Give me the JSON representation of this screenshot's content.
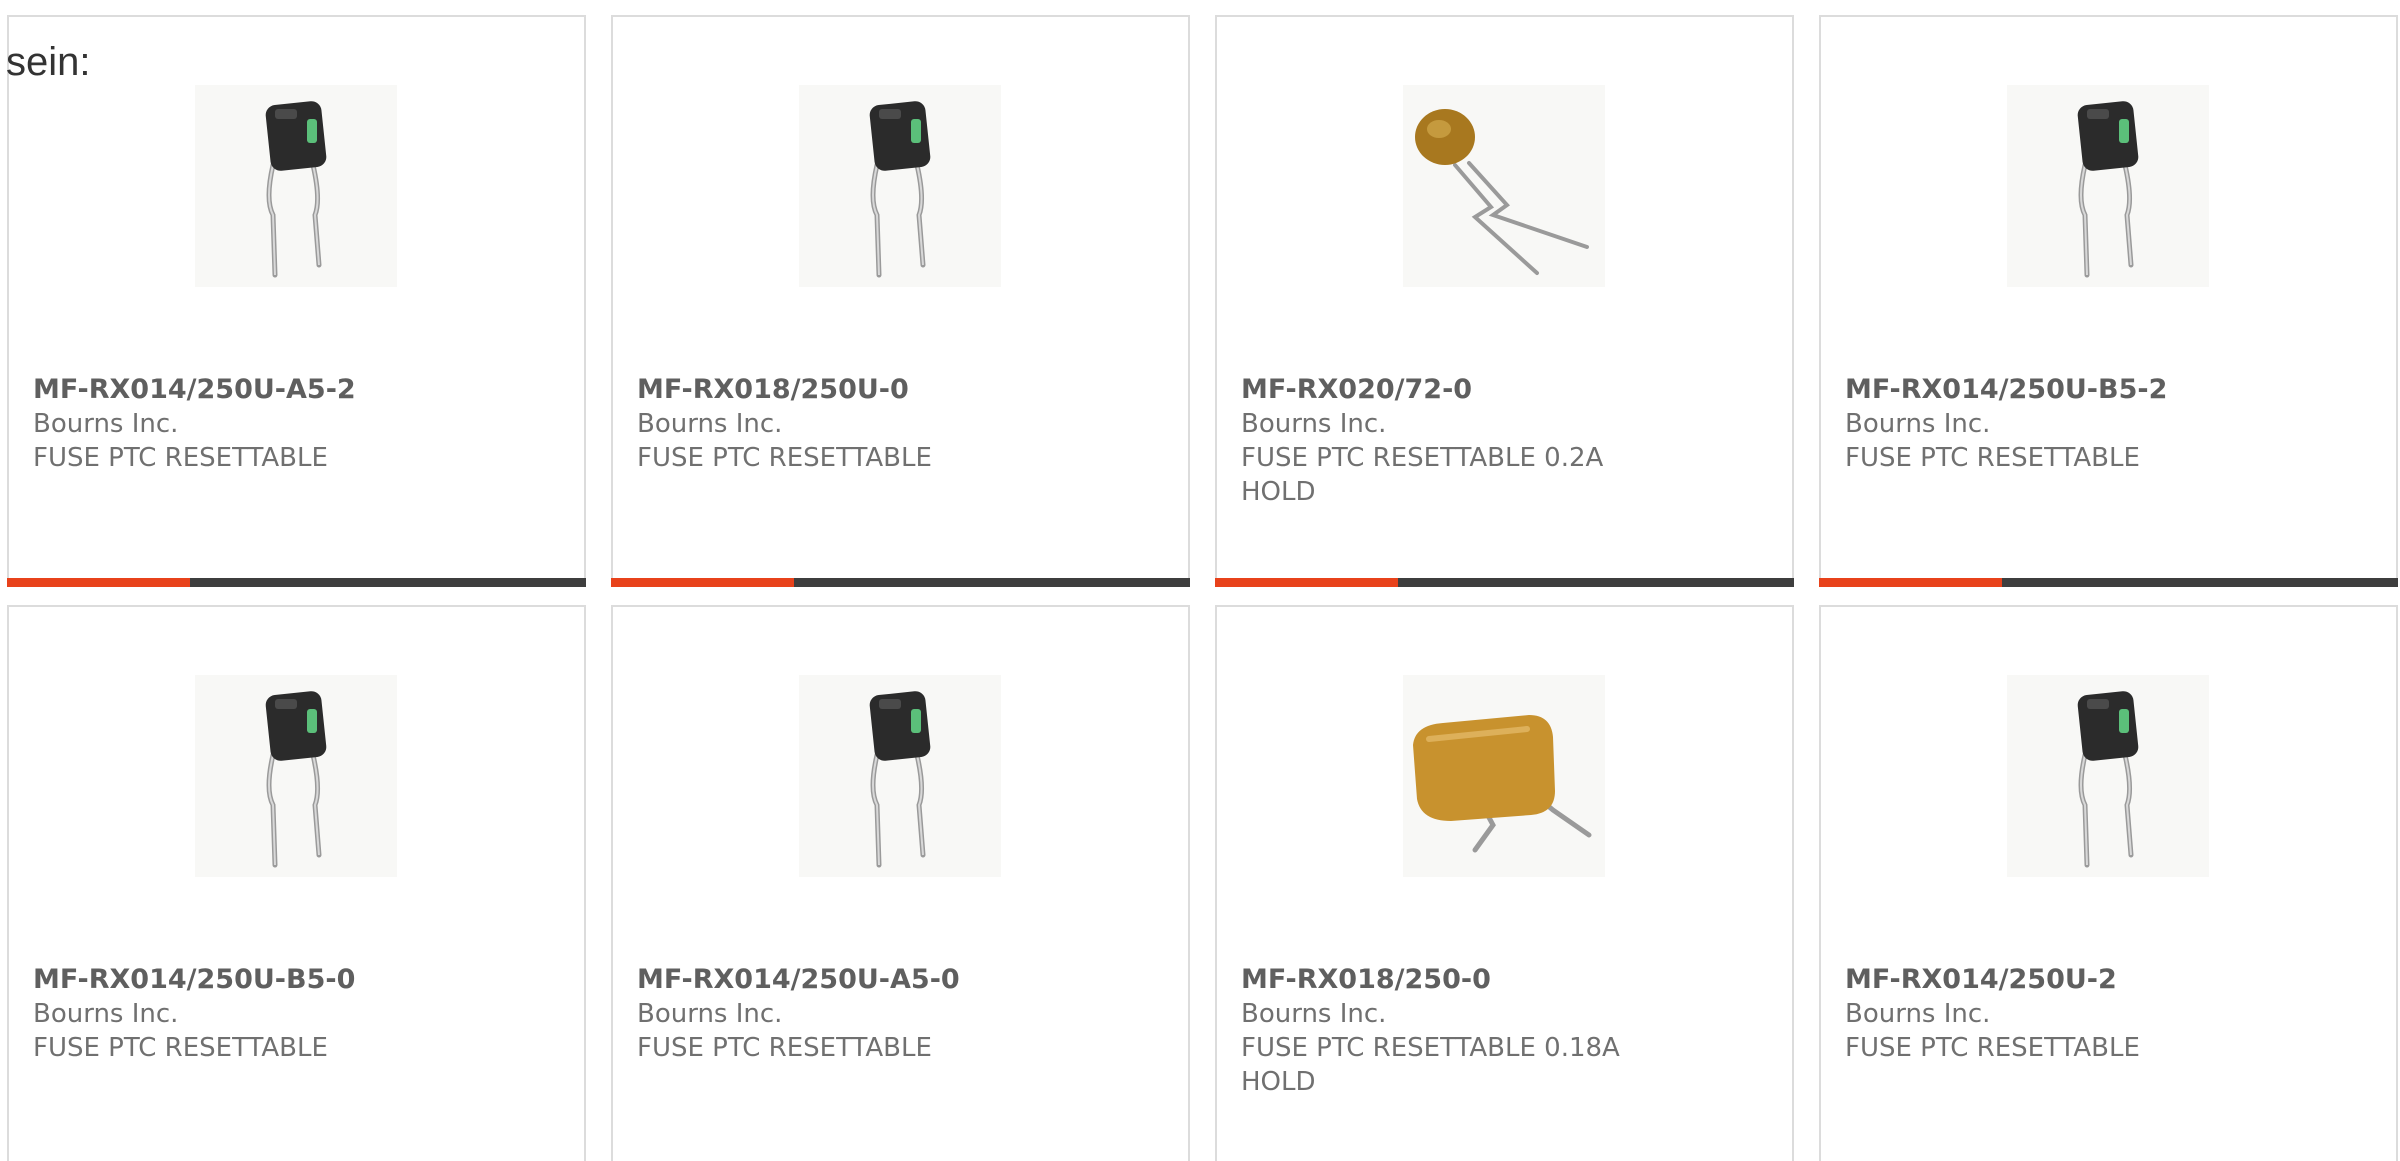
{
  "lead_text": "sein:",
  "colors": {
    "accent": "#e8421b",
    "bar": "#3e3e3e",
    "border": "#dcdcdc"
  },
  "products": [
    {
      "part": "MF-RX014/250U-A5-2",
      "maker": "Bourns Inc.",
      "desc": "FUSE PTC RESETTABLE",
      "image": "square-radial-ptc-image"
    },
    {
      "part": "MF-RX018/250U-0",
      "maker": "Bourns Inc.",
      "desc": "FUSE PTC RESETTABLE",
      "image": "square-radial-ptc-image"
    },
    {
      "part": "MF-RX020/72-0",
      "maker": "Bourns Inc.",
      "desc": "FUSE PTC RESETTABLE 0.2A HOLD",
      "image": "round-disc-ptc-image"
    },
    {
      "part": "MF-RX014/250U-B5-2",
      "maker": "Bourns Inc.",
      "desc": "FUSE PTC RESETTABLE",
      "image": "square-radial-ptc-image"
    },
    {
      "part": "MF-RX014/250U-B5-0",
      "maker": "Bourns Inc.",
      "desc": "FUSE PTC RESETTABLE",
      "image": "square-radial-ptc-image"
    },
    {
      "part": "MF-RX014/250U-A5-0",
      "maker": "Bourns Inc.",
      "desc": "FUSE PTC RESETTABLE",
      "image": "square-radial-ptc-image"
    },
    {
      "part": "MF-RX018/250-0",
      "maker": "Bourns Inc.",
      "desc": "FUSE PTC RESETTABLE 0.18A HOLD",
      "image": "rect-disc-ptc-image"
    },
    {
      "part": "MF-RX014/250U-2",
      "maker": "Bourns Inc.",
      "desc": "FUSE PTC RESETTABLE",
      "image": "square-radial-ptc-image"
    }
  ]
}
